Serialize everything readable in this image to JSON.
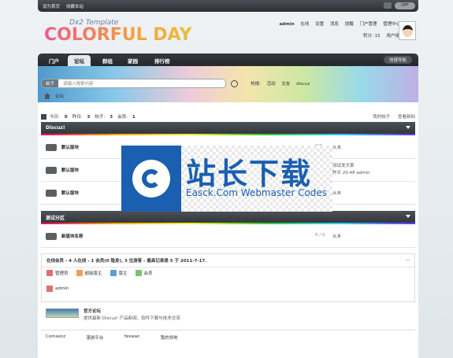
{
  "topbar": {
    "set_home": "设为首页",
    "bookmark": "收藏本站",
    "off_label": "OFF"
  },
  "logo": {
    "subtitle": "Dx2 Template",
    "title": "COLORFUL DAY"
  },
  "user": {
    "name": "admin",
    "status": "在线",
    "links": [
      "设置",
      "消息",
      "提醒",
      "门户管理",
      "管理中心",
      "退出"
    ],
    "points": "积分: 15",
    "group": "用户组: 管理员"
  },
  "nav": {
    "tabs": [
      "门户",
      "论坛",
      "群组",
      "家园",
      "排行榜"
    ],
    "active_index": 1,
    "quick": "快捷导航"
  },
  "search": {
    "scope": "帖子",
    "placeholder": "请输入搜索内容",
    "hot_label": "热搜:",
    "hot_terms": [
      "活动",
      "交友",
      "discuz"
    ]
  },
  "breadcrumb": {
    "current": "论坛"
  },
  "stats": {
    "today_label": "今日:",
    "today": "0",
    "yesterday_label": "昨日:",
    "yesterday": "3",
    "posts_label": "帖子:",
    "posts": "3",
    "members_label": "会员:",
    "members": "1"
  },
  "myposts": {
    "mine": "我的帖子",
    "new": "查看新帖"
  },
  "categories": [
    {
      "title": "Discuz!"
    },
    {
      "title": "测试分区"
    }
  ],
  "forums": [
    {
      "name": "默认版块",
      "count": "0/0",
      "last": "从未"
    },
    {
      "name": "默认版块",
      "count": "",
      "last": "测试发文章",
      "last_time": "昨天 20:48 admin"
    },
    {
      "name": "默认版块",
      "count": "",
      "last": "从未"
    },
    {
      "name": "新版块名称",
      "count": "0 / 0",
      "last": "从未"
    }
  ],
  "online": {
    "headline": "在线会员 - 4 人在线 - 1 会员(0 隐身), 3 位游客 - 最高记录是 5 于 2011-7-17.",
    "legend": [
      {
        "label": "管理员",
        "color": "#e07070"
      },
      {
        "label": "超级版主",
        "color": "#f0a050"
      },
      {
        "label": "版主",
        "color": "#5aa0d8"
      },
      {
        "label": "会员",
        "color": "#7cc26a"
      }
    ],
    "members": [
      "admin"
    ]
  },
  "links": {
    "title": "官方论坛",
    "desc": "提供最新 Discuz! 产品新闻、软件下载与技术交流",
    "partners": [
      "Comsenz",
      "漫游平台",
      "Yeswan",
      "我的领地"
    ]
  },
  "watermark": {
    "cn": "站长下载",
    "en": "Easck.Com Webmaster Codes"
  }
}
